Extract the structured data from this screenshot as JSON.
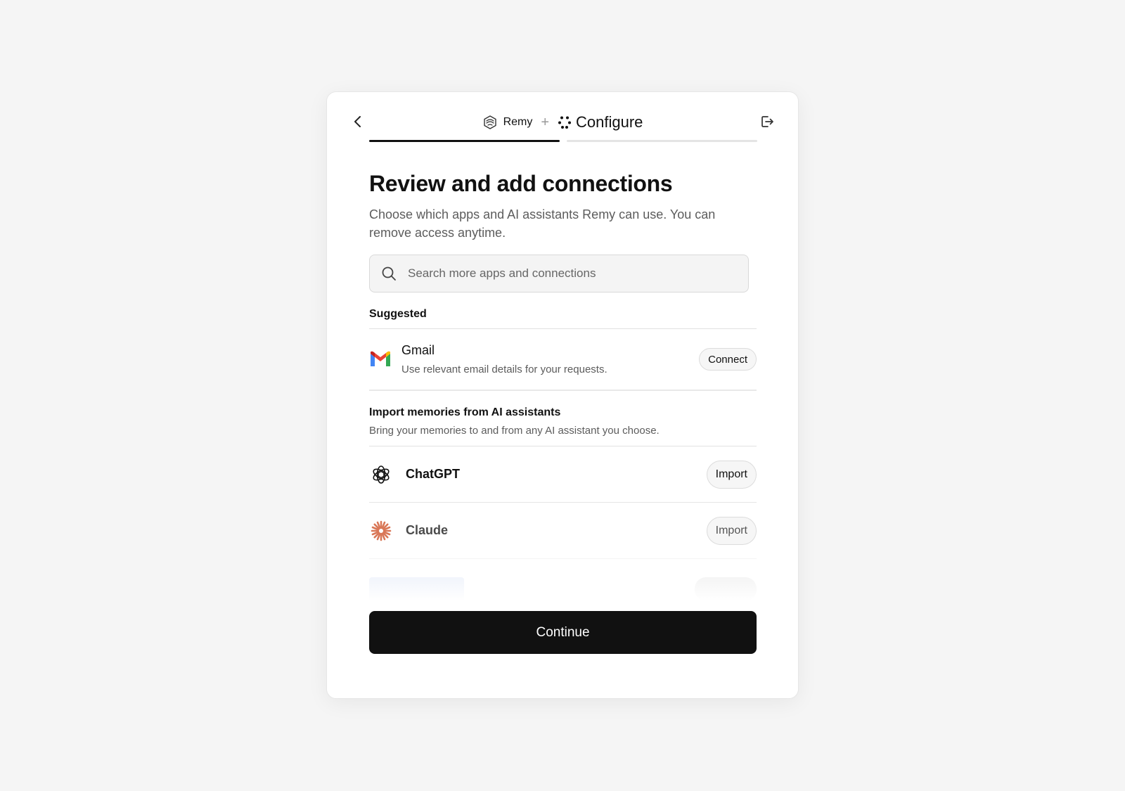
{
  "header": {
    "brand_name": "Remy",
    "plus": "+",
    "step_title": "Configure",
    "progress_fraction": 0.5
  },
  "main": {
    "title": "Review and add connections",
    "subtitle": "Choose which apps and AI assistants Remy can use. You can remove access anytime.",
    "search": {
      "placeholder": "Search more apps and connections",
      "value": ""
    },
    "suggested": {
      "label": "Suggested",
      "items": [
        {
          "name": "Gmail",
          "description": "Use relevant email details for your requests.",
          "action_label": "Connect",
          "icon": "gmail-icon"
        }
      ]
    },
    "import_section": {
      "title": "Import memories from AI assistants",
      "description": "Bring your memories to and from any AI assistant you choose.",
      "items": [
        {
          "name": "ChatGPT",
          "action_label": "Import",
          "icon": "chatgpt-icon"
        },
        {
          "name": "Claude",
          "action_label": "Import",
          "icon": "claude-icon"
        }
      ]
    }
  },
  "footer": {
    "continue_label": "Continue"
  },
  "colors": {
    "background": "#f5f5f5",
    "primary_button": "#111111",
    "claude_orange": "#d97757",
    "gmail_red": "#ea4335",
    "gmail_blue": "#4285f4",
    "gmail_green": "#34a853",
    "gmail_yellow": "#fbbc04"
  }
}
